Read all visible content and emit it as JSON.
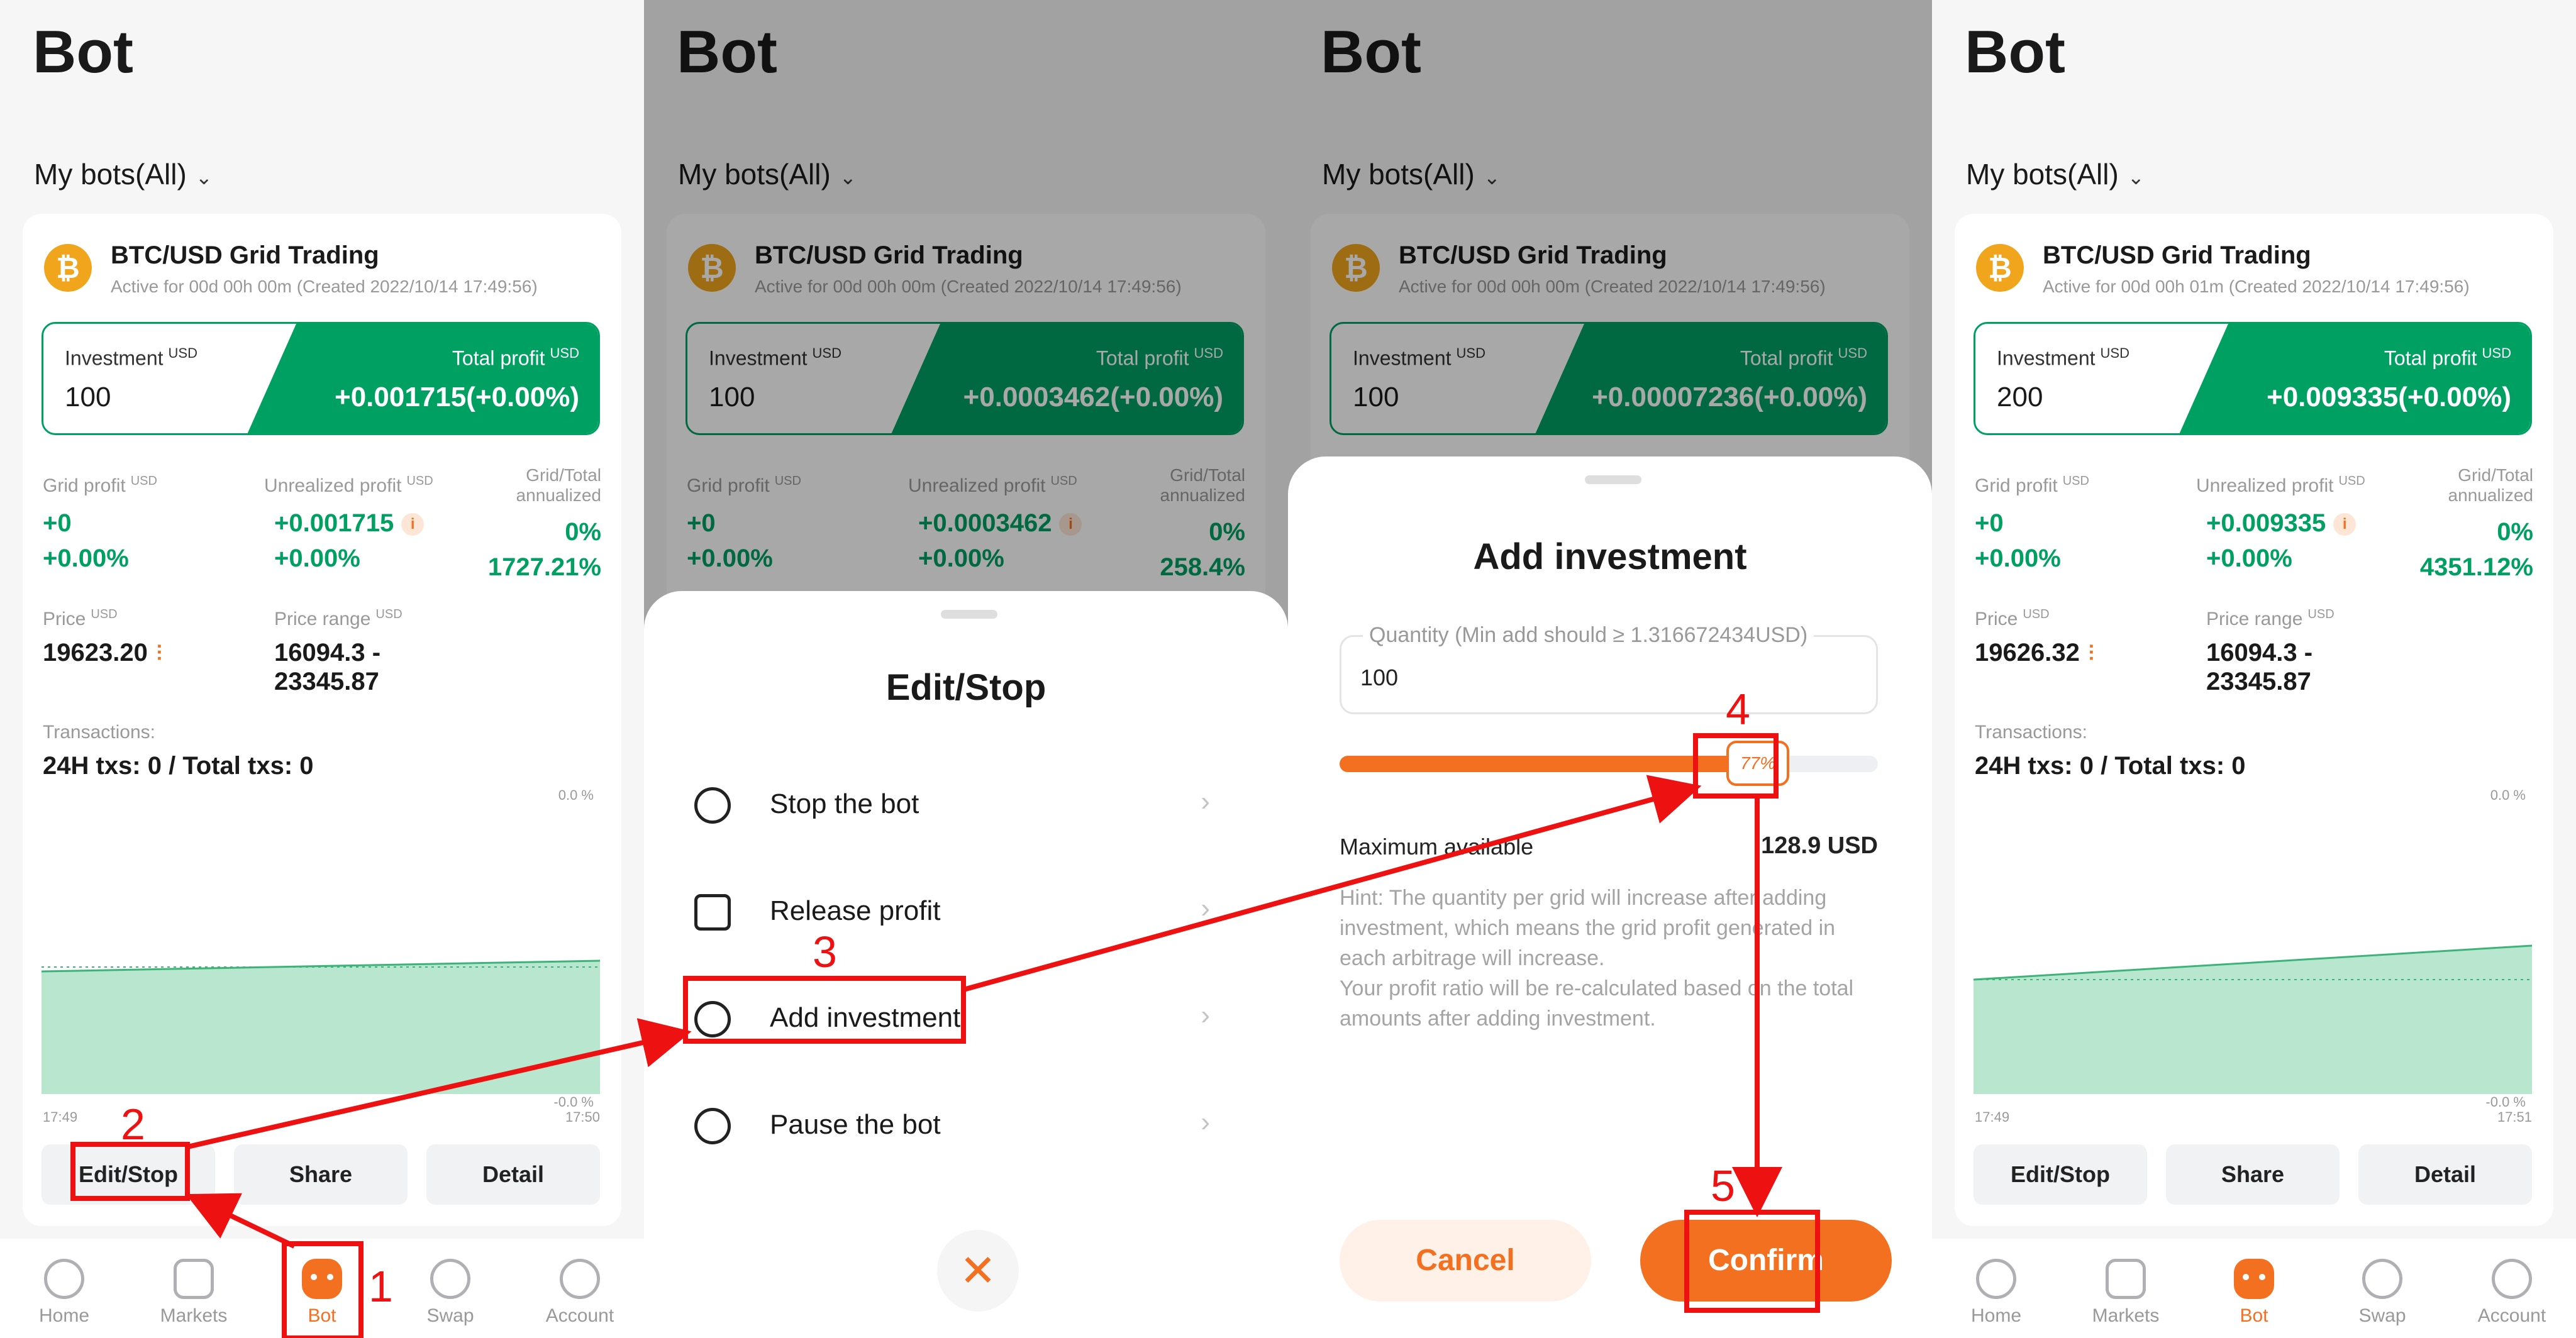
{
  "colors": {
    "accent": "#f37021",
    "profit_green": "#00a063",
    "annotation_red": "#ee1111"
  },
  "common": {
    "title": "Bot",
    "filter_label": "My bots(All)",
    "bot_name": "BTC/USD Grid Trading",
    "coin_symbol": "₿",
    "investment_label": "Investment",
    "total_profit_label": "Total profit",
    "usd_unit": "USD",
    "grid_profit_label": "Grid profit",
    "unrealized_profit_label": "Unrealized profit",
    "annualized_label_line1": "Grid/Total",
    "annualized_label_line2": "annualized",
    "price_label": "Price",
    "price_range_label": "Price range",
    "transactions_label": "Transactions:",
    "buttons": {
      "edit_stop": "Edit/Stop",
      "share": "Share",
      "detail": "Detail"
    },
    "tabs": [
      {
        "label": "Home",
        "icon": "home-icon"
      },
      {
        "label": "Markets",
        "icon": "markets-icon"
      },
      {
        "label": "Bot",
        "icon": "bot-icon"
      },
      {
        "label": "Swap",
        "icon": "swap-icon"
      },
      {
        "label": "Account",
        "icon": "account-icon"
      }
    ]
  },
  "panels": [
    {
      "active_text": "Active for 00d 00h 00m (Created 2022/10/14 17:49:56)",
      "investment": "100",
      "total_profit": "+0.001715(+0.00%)",
      "grid_profit": "+0",
      "grid_profit_pct": "+0.00%",
      "unrealized_profit": "+0.001715",
      "unrealized_pct": "+0.00%",
      "annualized_1": "0%",
      "annualized_2": "1727.21%",
      "price": "19623.20",
      "range_low": "16094.3 -",
      "range_high": "23345.87",
      "txs": "24H txs: 0 / Total txs: 0",
      "chart_pct_top": "0.0 %",
      "chart_pct_bottom": "-0.0 %",
      "time_start": "17:49",
      "time_end": "17:50"
    },
    {
      "active_text": "Active for 00d 00h 00m (Created 2022/10/14 17:49:56)",
      "investment": "100",
      "total_profit": "+0.0003462(+0.00%)",
      "grid_profit": "+0",
      "grid_profit_pct": "+0.00%",
      "unrealized_profit": "+0.0003462",
      "unrealized_pct": "+0.00%",
      "annualized_1": "0%",
      "annualized_2": "258.4%"
    },
    {
      "active_text": "Active for 00d 00h 00m (Created 2022/10/14 17:49:56)",
      "investment": "100",
      "total_profit": "+0.00007236(+0.00%)"
    },
    {
      "active_text": "Active for 00d 00h 01m (Created 2022/10/14 17:49:56)",
      "investment": "200",
      "total_profit": "+0.009335(+0.00%)",
      "grid_profit": "+0",
      "grid_profit_pct": "+0.00%",
      "unrealized_profit": "+0.009335",
      "unrealized_pct": "+0.00%",
      "annualized_1": "0%",
      "annualized_2": "4351.12%",
      "price": "19626.32",
      "range_low": "16094.3 -",
      "range_high": "23345.87",
      "txs": "24H txs: 0 / Total txs: 0",
      "chart_pct_top": "0.0 %",
      "chart_pct_bottom": "-0.0 %",
      "time_start": "17:49",
      "time_end": "17:51"
    }
  ],
  "edit_stop_sheet": {
    "title": "Edit/Stop",
    "items": [
      {
        "label": "Stop the bot",
        "icon": "power-icon"
      },
      {
        "label": "Release profit",
        "icon": "release-profit-icon"
      },
      {
        "label": "Add investment",
        "icon": "add-investment-icon"
      },
      {
        "label": "Pause the bot",
        "icon": "pause-icon"
      }
    ],
    "close_glyph": "✕"
  },
  "add_investment_sheet": {
    "title": "Add investment",
    "quantity_placeholder": "Quantity (Min add should ≥ 1.316672434USD)",
    "quantity_value": "100",
    "slider_percent": 77,
    "slider_label": "77%",
    "max_label": "Maximum available",
    "max_value": "128.9 USD",
    "hint_1": "Hint: The quantity per grid will increase after adding investment, which means the grid profit generated in each arbitrage will increase.",
    "hint_2": "Your profit ratio will be re-calculated based on the total amounts after adding investment.",
    "cancel": "Cancel",
    "confirm": "Confirm"
  },
  "annotations": {
    "steps": [
      "1",
      "2",
      "3",
      "4",
      "5"
    ]
  }
}
